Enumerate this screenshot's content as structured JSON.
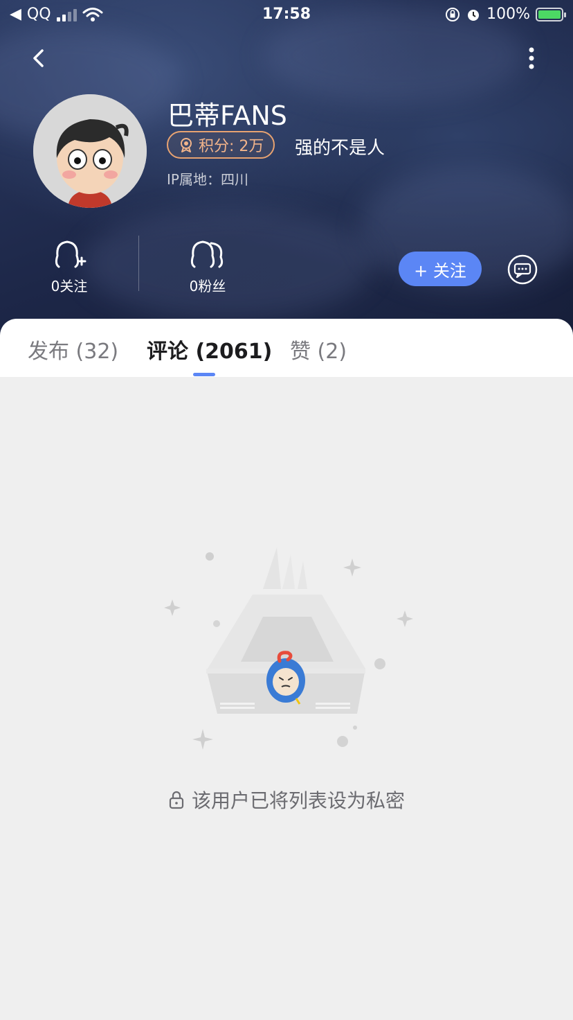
{
  "status_bar": {
    "carrier": "QQ",
    "time": "17:58",
    "battery": "100%"
  },
  "profile": {
    "name": "巴蒂FANS",
    "points_label": "积分: 2万",
    "title": "强的不是人",
    "ip_location": "IP属地：四川"
  },
  "stats": {
    "following": "0关注",
    "fans": "0粉丝"
  },
  "actions": {
    "follow_label": "+ 关注"
  },
  "tabs": [
    {
      "label": "发布 (32)",
      "active": false
    },
    {
      "label": "评论 (2061)",
      "active": true
    },
    {
      "label": "赞 (2)",
      "active": false
    }
  ],
  "empty_state": {
    "message": "该用户已将列表设为私密"
  },
  "colors": {
    "accent": "#5b86f5",
    "badge": "#e8a371",
    "header_dark": "#1d2748"
  }
}
